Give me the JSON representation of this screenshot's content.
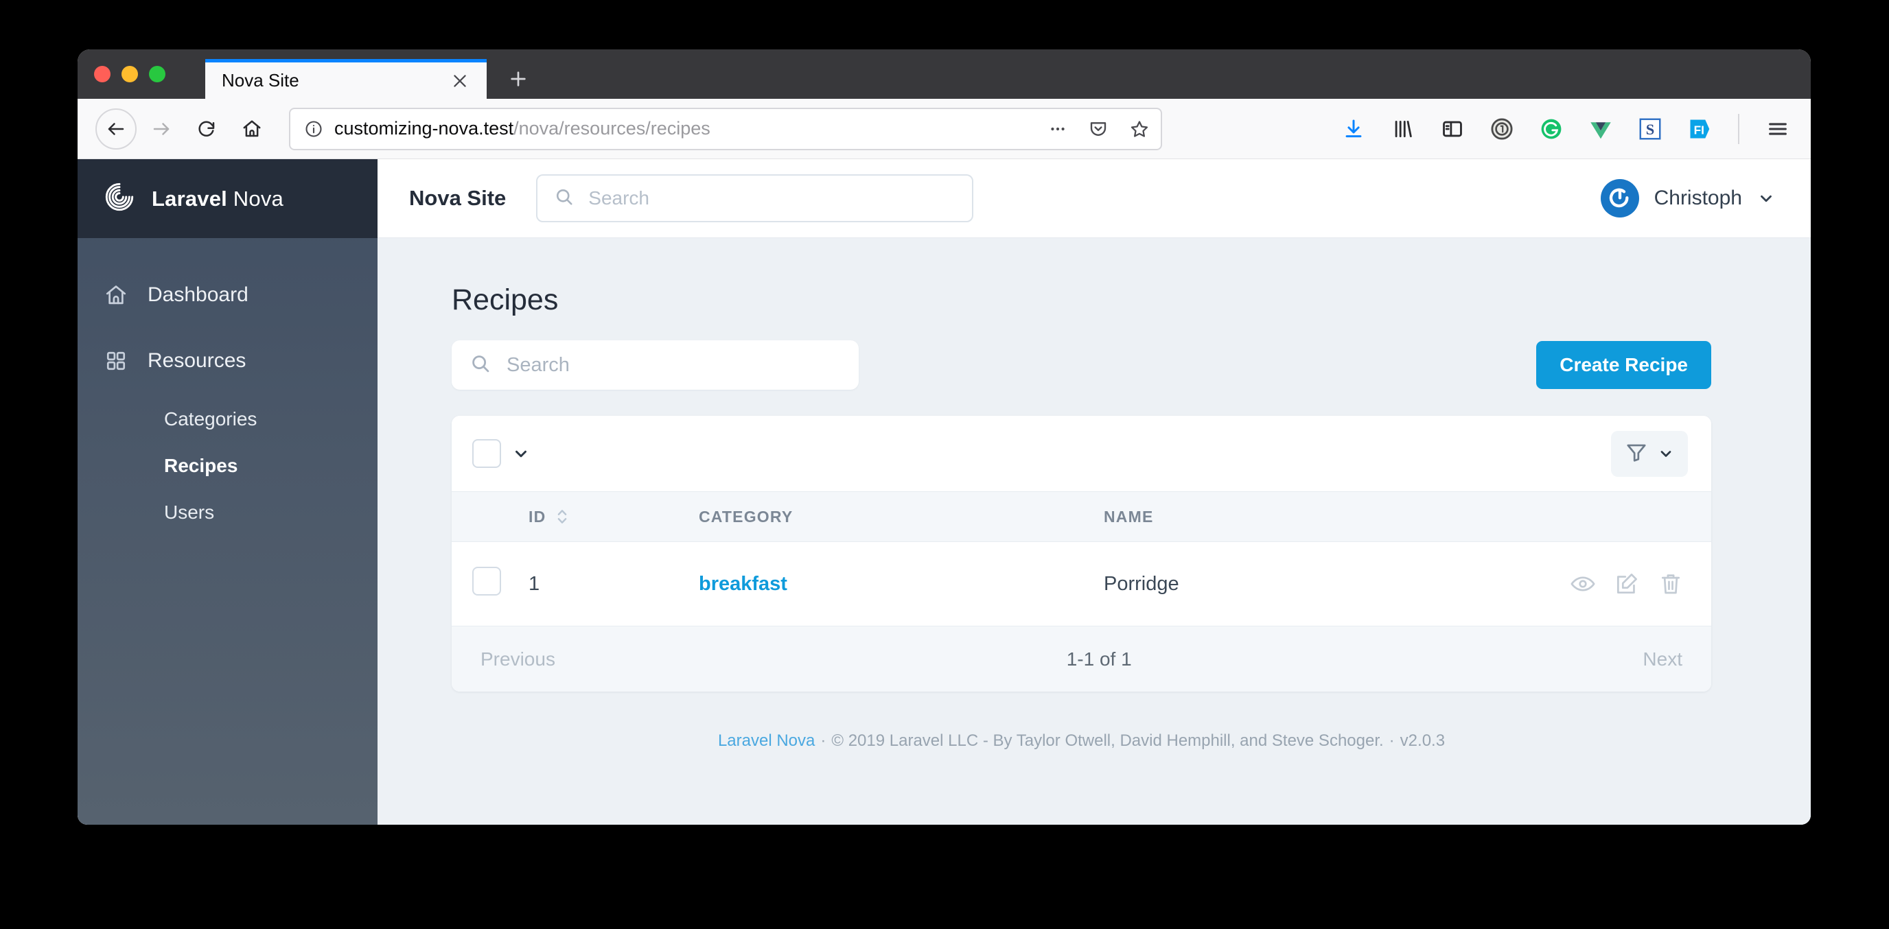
{
  "browser": {
    "tab": {
      "title": "Nova Site",
      "close_icon": "close-icon"
    },
    "new_tab_icon": "plus-icon",
    "nav": {
      "back_icon": "arrow-left-icon",
      "forward_icon": "arrow-right-icon",
      "reload_icon": "reload-icon",
      "home_icon": "home-icon"
    },
    "url": {
      "info_icon": "info-circle-icon",
      "domain": "customizing-nova.test",
      "path": "/nova/resources/recipes",
      "page_actions_icon": "ellipsis-icon",
      "pocket_icon": "pocket-icon",
      "bookmark_icon": "star-icon"
    },
    "toolbar_icons": [
      "downloads-icon",
      "library-icon",
      "sidebar-icon",
      "1password-icon",
      "grammarly-icon",
      "vue-devtools-icon",
      "s-extension-icon",
      "fi-extension-icon",
      "menu-icon"
    ],
    "accent_color": "#0a84ff"
  },
  "sidebar": {
    "brand_strong": "Laravel",
    "brand_light": " Nova",
    "logo_icon": "nova-spiral-logo-icon",
    "items": [
      {
        "label": "Dashboard",
        "icon": "home-icon",
        "type": "main",
        "active": false
      },
      {
        "label": "Resources",
        "icon": "grid-icon",
        "type": "main",
        "active": false
      },
      {
        "label": "Categories",
        "type": "sub",
        "active": false
      },
      {
        "label": "Recipes",
        "type": "sub",
        "active": true
      },
      {
        "label": "Users",
        "type": "sub",
        "active": false
      }
    ]
  },
  "header": {
    "site_name": "Nova Site",
    "search_placeholder": "Search",
    "search_icon": "search-icon",
    "user_name": "Christoph",
    "avatar_icon": "avatar-icon",
    "user_chevron_icon": "chevron-down-icon"
  },
  "main": {
    "title": "Recipes",
    "search_placeholder": "Search",
    "search_icon": "search-icon",
    "create_button": "Create Recipe",
    "create_button_color": "#0f9bdb"
  },
  "card": {
    "select_all_checkbox": "select-all-checkbox",
    "select_all_chevron_icon": "chevron-down-icon",
    "filter_icon": "filter-funnel-icon",
    "filter_chevron_icon": "chevron-down-icon"
  },
  "table": {
    "columns": [
      "ID",
      "CATEGORY",
      "NAME"
    ],
    "sort_icon": "sort-arrows-icon",
    "rows": [
      {
        "id": "1",
        "category": "breakfast",
        "name": "Porridge",
        "actions": [
          "view-icon",
          "edit-icon",
          "delete-icon"
        ]
      }
    ]
  },
  "pagination": {
    "previous": "Previous",
    "range": "1-1 of 1",
    "next": "Next"
  },
  "footer": {
    "link": "Laravel Nova",
    "separator": "·",
    "copyright": "© 2019 Laravel LLC - By Taylor Otwell, David Hemphill, and Steve Schoger.",
    "version": "v2.0.3"
  }
}
